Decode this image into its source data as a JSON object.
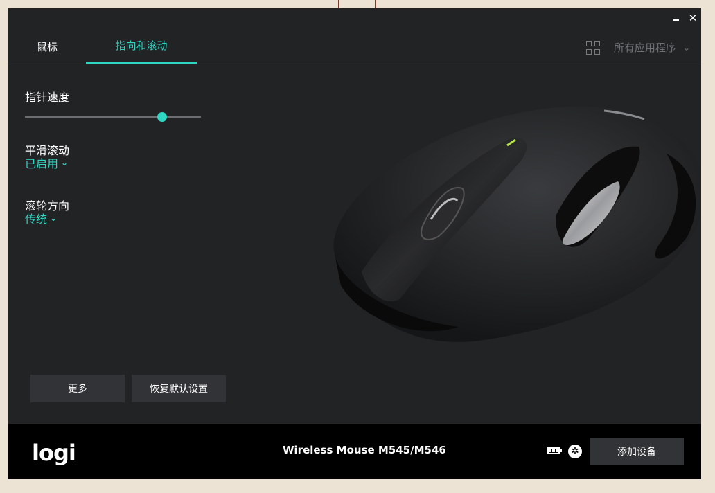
{
  "titlebar": {
    "minimize_glyph": "",
    "close_glyph": "✕"
  },
  "tabs": [
    {
      "label": "鼠标",
      "active": false
    },
    {
      "label": "指向和滚动",
      "active": true
    }
  ],
  "apps_selector": {
    "label": "所有应用程序",
    "icon": "grid-icon"
  },
  "pointer_speed": {
    "label": "指针速度",
    "level": 0.78
  },
  "smooth_scrolling": {
    "label": "平滑滚动",
    "value": "已启用"
  },
  "scroll_direction": {
    "label": "滚轮方向",
    "value": "传统"
  },
  "buttons": {
    "more": "更多",
    "restore_defaults": "恢复默认设置"
  },
  "footer": {
    "logo": "logi",
    "device_name": "Wireless Mouse M545/M546",
    "add_device": "添加设备",
    "battery_icon": "battery-icon",
    "receiver_icon": "unifying-receiver-icon"
  },
  "colors": {
    "accent": "#2fd7c3",
    "window_bg": "#222325",
    "footer_bg": "#000000",
    "button_bg": "#323336"
  }
}
